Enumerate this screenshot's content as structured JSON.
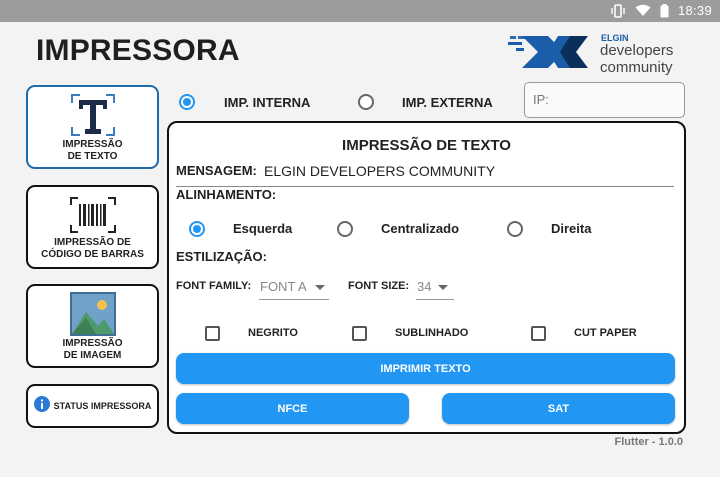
{
  "status_bar": {
    "time": "18:39"
  },
  "header": {
    "title": "IMPRESSORA",
    "logo": {
      "brand": "ELGIN",
      "line1": "developers",
      "line2": "community",
      "color": "#1a5da8"
    }
  },
  "sidebar": {
    "items": [
      {
        "label": "IMPRESSÃO\nDE TEXTO",
        "icon": "text-icon",
        "active": true
      },
      {
        "label": "IMPRESSÃO DE\nCÓDIGO DE BARRAS",
        "icon": "barcode-icon",
        "active": false
      },
      {
        "label": "IMPRESSÃO\nDE IMAGEM",
        "icon": "image-icon",
        "active": false
      },
      {
        "label": "STATUS IMPRESSORA",
        "icon": "info-icon",
        "active": false
      }
    ]
  },
  "connection": {
    "internal_label": "IMP. INTERNA",
    "external_label": "IMP. EXTERNA",
    "selected": "internal",
    "ip_placeholder": "IP:"
  },
  "panel": {
    "title": "IMPRESSÃO DE TEXTO",
    "message_label": "MENSAGEM:",
    "message_value": "ELGIN DEVELOPERS COMMUNITY",
    "alignment_label": "ALINHAMENTO:",
    "alignment_options": [
      "Esquerda",
      "Centralizado",
      "Direita"
    ],
    "alignment_selected": "Esquerda",
    "styling_label": "ESTILIZAÇÃO:",
    "font_family_label": "FONT FAMILY:",
    "font_family_value": "FONT A",
    "font_size_label": "FONT SIZE:",
    "font_size_value": "34",
    "checkboxes": [
      "NEGRITO",
      "SUBLINHADO",
      "CUT PAPER"
    ],
    "print_button": "IMPRIMIR TEXTO",
    "nfce_button": "NFCE",
    "sat_button": "SAT"
  },
  "footer": {
    "version": "Flutter - 1.0.0"
  },
  "colors": {
    "accent": "#2196f3",
    "active_border": "#1f6aa8"
  }
}
